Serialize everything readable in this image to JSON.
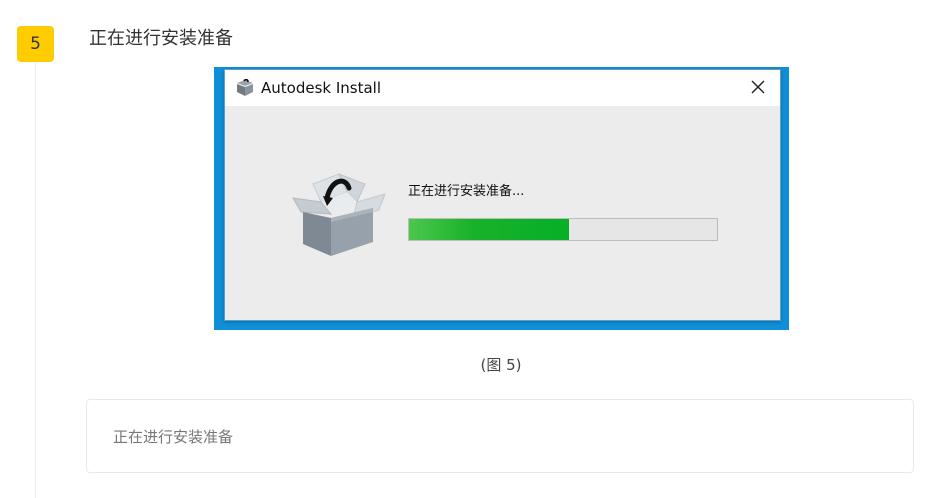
{
  "step": {
    "number": "5",
    "title": "正在进行安装准备",
    "badge_color": "#ffcc00"
  },
  "screenshot": {
    "frame_color": "#0f8fd6",
    "dialog": {
      "title": "Autodesk Install",
      "app_icon": "autodesk-installer-icon",
      "close_icon": "close-icon",
      "illustration": "open-box-icon",
      "status_text": "正在进行安装准备...",
      "progress_percent": 52,
      "progress_color": "#06b025"
    }
  },
  "caption": "(图 5)",
  "note": {
    "text": "正在进行安装准备"
  }
}
